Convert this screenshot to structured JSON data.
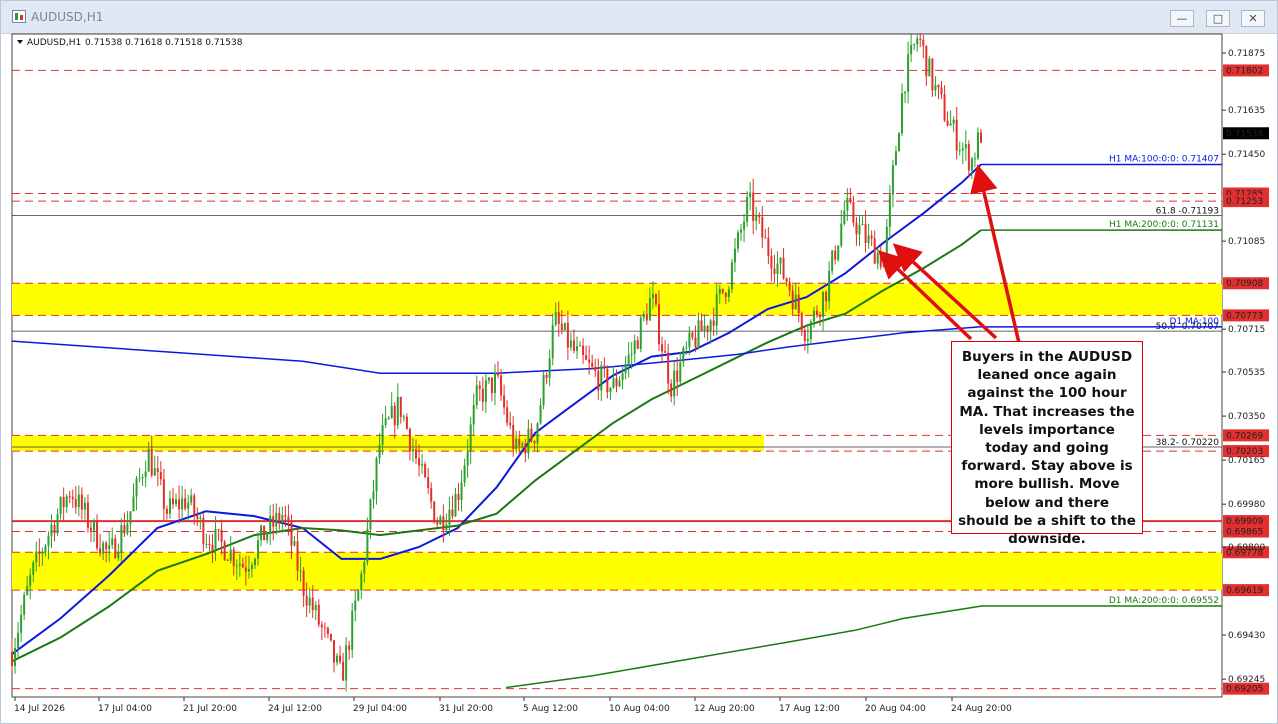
{
  "window": {
    "title": "AUDUSD,H1",
    "minimize_label": "—",
    "maximize_label": "□",
    "close_label": "✕",
    "app_icon": "chart-window-icon"
  },
  "header": {
    "symbol_label": "AUDUSD,H1",
    "ohlc": "0.71538 0.71618 0.71518 0.71538",
    "menu_icon": "triangle-down-icon"
  },
  "callout_text": "Buyers in the AUDUSD leaned once again against the 100 hour MA. That increases the levels importance today and going forward. Stay above is more bullish. Move below and there should be a shift to the downside.",
  "chart_data": {
    "type": "line",
    "subtype": "candlestick",
    "title": "AUDUSD,H1",
    "xlabel": "",
    "ylabel": "",
    "ylim": [
      0.6917,
      0.71955
    ],
    "x_ticks": [
      "14 Jul 2026",
      "17 Jul 04:00",
      "21 Jul 20:00",
      "24 Jul 12:00",
      "29 Jul 04:00",
      "31 Jul 20:00",
      "5 Aug 12:00",
      "10 Aug 04:00",
      "12 Aug 20:00",
      "17 Aug 12:00",
      "20 Aug 04:00",
      "24 Aug 20:00"
    ],
    "y_ticks": [
      "0.71875",
      "0.71635",
      "0.71450",
      "0.71085",
      "0.70715",
      "0.70535",
      "0.70350",
      "0.70165",
      "0.69980",
      "0.69800",
      "0.69430",
      "0.69245"
    ],
    "price_path": [
      [
        0,
        0.6936
      ],
      [
        0.02,
        0.6968
      ],
      [
        0.04,
        0.6988
      ],
      [
        0.06,
        0.7004
      ],
      [
        0.08,
        0.699
      ],
      [
        0.1,
        0.6976
      ],
      [
        0.12,
        0.6992
      ],
      [
        0.14,
        0.702
      ],
      [
        0.16,
        0.6995
      ],
      [
        0.18,
        0.7
      ],
      [
        0.2,
        0.6985
      ],
      [
        0.22,
        0.698
      ],
      [
        0.24,
        0.6972
      ],
      [
        0.26,
        0.6985
      ],
      [
        0.28,
        0.6994
      ],
      [
        0.3,
        0.6964
      ],
      [
        0.32,
        0.6945
      ],
      [
        0.34,
        0.6925
      ],
      [
        0.36,
        0.6966
      ],
      [
        0.38,
        0.7025
      ],
      [
        0.4,
        0.704
      ],
      [
        0.42,
        0.7013
      ],
      [
        0.44,
        0.699
      ],
      [
        0.46,
        0.7002
      ],
      [
        0.48,
        0.7043
      ],
      [
        0.5,
        0.705
      ],
      [
        0.52,
        0.702
      ],
      [
        0.54,
        0.7028
      ],
      [
        0.56,
        0.7075
      ],
      [
        0.58,
        0.7062
      ],
      [
        0.6,
        0.7053
      ],
      [
        0.62,
        0.7047
      ],
      [
        0.64,
        0.7062
      ],
      [
        0.66,
        0.7085
      ],
      [
        0.68,
        0.7048
      ],
      [
        0.7,
        0.7065
      ],
      [
        0.72,
        0.7075
      ],
      [
        0.74,
        0.7093
      ],
      [
        0.76,
        0.7125
      ],
      [
        0.78,
        0.7105
      ],
      [
        0.8,
        0.7092
      ],
      [
        0.82,
        0.707
      ],
      [
        0.84,
        0.7088
      ],
      [
        0.86,
        0.7123
      ],
      [
        0.88,
        0.711
      ],
      [
        0.9,
        0.71
      ],
      [
        0.91,
        0.714
      ],
      [
        0.92,
        0.7175
      ],
      [
        0.935,
        0.7195
      ],
      [
        0.95,
        0.7175
      ],
      [
        0.965,
        0.716
      ],
      [
        0.98,
        0.7148
      ],
      [
        0.99,
        0.7142
      ],
      [
        1.0,
        0.71538
      ]
    ],
    "series": [
      {
        "name": "H1 MA:100:0:0: 0.71407",
        "color": "#0b19e0",
        "values": [
          [
            0,
            0.6935
          ],
          [
            0.05,
            0.695
          ],
          [
            0.1,
            0.6968
          ],
          [
            0.15,
            0.6988
          ],
          [
            0.2,
            0.6995
          ],
          [
            0.25,
            0.6993
          ],
          [
            0.3,
            0.6988
          ],
          [
            0.34,
            0.6975
          ],
          [
            0.38,
            0.6975
          ],
          [
            0.42,
            0.698
          ],
          [
            0.46,
            0.6988
          ],
          [
            0.5,
            0.7005
          ],
          [
            0.54,
            0.7028
          ],
          [
            0.58,
            0.704
          ],
          [
            0.62,
            0.7052
          ],
          [
            0.66,
            0.706
          ],
          [
            0.7,
            0.7062
          ],
          [
            0.74,
            0.707
          ],
          [
            0.78,
            0.708
          ],
          [
            0.82,
            0.7085
          ],
          [
            0.86,
            0.7095
          ],
          [
            0.9,
            0.7108
          ],
          [
            0.94,
            0.712
          ],
          [
            0.98,
            0.7133
          ],
          [
            1.0,
            0.71407
          ]
        ]
      },
      {
        "name": "H1 MA:200:0:0: 0.71131",
        "color": "#1a7a0f",
        "values": [
          [
            0,
            0.6932
          ],
          [
            0.05,
            0.6942
          ],
          [
            0.1,
            0.6955
          ],
          [
            0.15,
            0.697
          ],
          [
            0.2,
            0.6977
          ],
          [
            0.25,
            0.6985
          ],
          [
            0.3,
            0.6988
          ],
          [
            0.34,
            0.6987
          ],
          [
            0.38,
            0.6985
          ],
          [
            0.42,
            0.6987
          ],
          [
            0.46,
            0.6989
          ],
          [
            0.5,
            0.6994
          ],
          [
            0.54,
            0.7008
          ],
          [
            0.58,
            0.702
          ],
          [
            0.62,
            0.7032
          ],
          [
            0.66,
            0.7042
          ],
          [
            0.7,
            0.705
          ],
          [
            0.74,
            0.7058
          ],
          [
            0.78,
            0.7066
          ],
          [
            0.82,
            0.7073
          ],
          [
            0.86,
            0.7078
          ],
          [
            0.9,
            0.7088
          ],
          [
            0.94,
            0.7097
          ],
          [
            0.98,
            0.7107
          ],
          [
            1.0,
            0.71131
          ]
        ]
      },
      {
        "name": "D1 MA:100",
        "color": "#0b19e0",
        "values": [
          [
            0,
            0.70665
          ],
          [
            0.3,
            0.7058
          ],
          [
            0.38,
            0.7053
          ],
          [
            0.5,
            0.7053
          ],
          [
            0.6,
            0.7055
          ],
          [
            0.68,
            0.7058
          ],
          [
            0.75,
            0.7061
          ],
          [
            0.8,
            0.7064
          ],
          [
            0.86,
            0.7067
          ],
          [
            0.92,
            0.707
          ],
          [
            1.0,
            0.70725
          ]
        ]
      },
      {
        "name": "D1 MA:200:0:0: 0.69552",
        "color": "#1a7a0f",
        "values": [
          [
            0.51,
            0.6921
          ],
          [
            0.6,
            0.6926
          ],
          [
            0.7,
            0.6933
          ],
          [
            0.8,
            0.694
          ],
          [
            0.87,
            0.6945
          ],
          [
            0.92,
            0.695
          ],
          [
            1.0,
            0.69552
          ]
        ]
      }
    ],
    "zones": [
      {
        "from": 0.70773,
        "to": 0.70908,
        "color": "#ffff00"
      },
      {
        "from": 0.70203,
        "to": 0.70269,
        "color": "#ffff00"
      },
      {
        "from": 0.69619,
        "to": 0.69778,
        "color": "#ffff00"
      }
    ],
    "levels": [
      {
        "value": 0.71802,
        "label": "0.71802",
        "color": "#e23030",
        "dashed": true
      },
      {
        "value": 0.71285,
        "label": "0.71285",
        "color": "#e23030",
        "dashed": true
      },
      {
        "value": 0.71253,
        "label": "0.71253",
        "color": "#e23030",
        "dashed": true
      },
      {
        "value": 0.70908,
        "label": "0.70908",
        "color": "#e23030",
        "dashed": true
      },
      {
        "value": 0.70773,
        "label": "0.70773",
        "color": "#e23030",
        "dashed": true
      },
      {
        "value": 0.70269,
        "label": "0.70269",
        "color": "#e23030",
        "dashed": true
      },
      {
        "value": 0.70203,
        "label": "0.70203",
        "color": "#e23030",
        "dashed": true
      },
      {
        "value": 0.69909,
        "label": "0.69909",
        "color": "#e23030",
        "dashed": false
      },
      {
        "value": 0.69865,
        "label": "0.69865",
        "color": "#e23030",
        "dashed": true
      },
      {
        "value": 0.69778,
        "label": "0.69778",
        "color": "#e23030",
        "dashed": true
      },
      {
        "value": 0.69619,
        "label": "0.69619",
        "color": "#e23030",
        "dashed": true
      },
      {
        "value": 0.69205,
        "label": "0.69205",
        "color": "#e23030",
        "dashed": true
      }
    ],
    "fib_levels": [
      {
        "value": 0.71193,
        "label": "61.8 -0.71193"
      },
      {
        "value": 0.70707,
        "label": "50.0 -0.70707"
      },
      {
        "value": 0.7022,
        "label": "38.2- 0.70220"
      }
    ],
    "current_price": {
      "value": 0.71538,
      "label": "0.71538"
    },
    "grid": false,
    "legend": "none"
  }
}
